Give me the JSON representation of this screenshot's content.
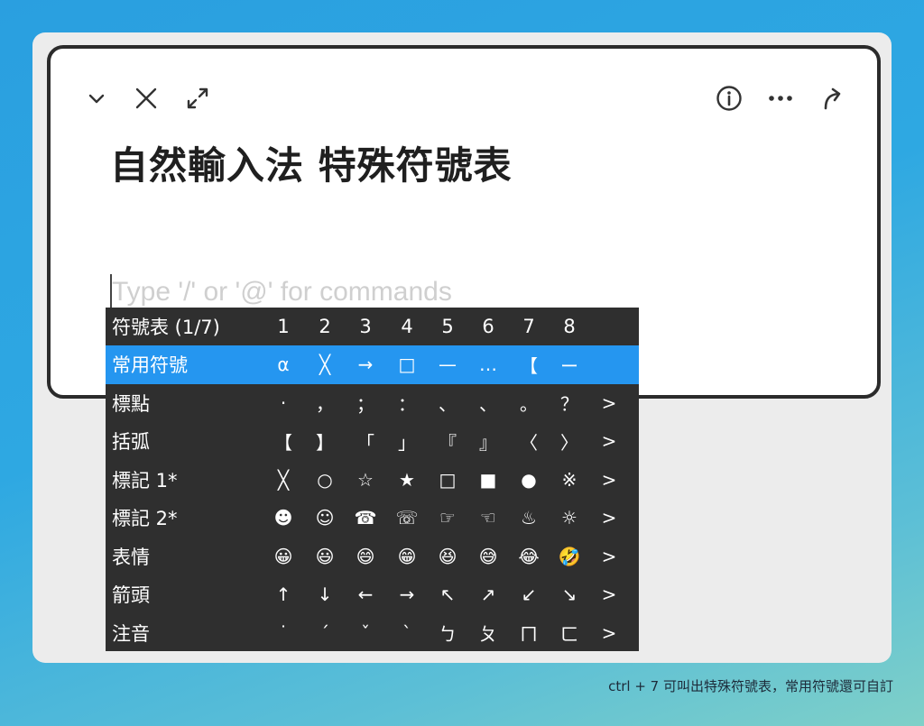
{
  "toolbar": {
    "left_icons": [
      "chevron-down-icon",
      "close-icon",
      "expand-icon"
    ],
    "right_icons": [
      "info-icon",
      "more-icon",
      "share-icon"
    ]
  },
  "page": {
    "title": "自然輸入法 特殊符號表",
    "placeholder": "Type '/' or '@' for commands"
  },
  "palette": {
    "header": {
      "label": "符號表 (1/7)",
      "columns": [
        "1",
        "2",
        "3",
        "4",
        "5",
        "6",
        "7",
        "8"
      ]
    },
    "rows": [
      {
        "label": "常用符號",
        "symbols": [
          "α",
          "╳",
          "→",
          "□",
          "—",
          "…",
          "【",
          "ー"
        ],
        "arrow": "",
        "selected": true
      },
      {
        "label": "標點",
        "symbols": [
          "·",
          "，",
          "；",
          "：",
          "、",
          "、",
          "。",
          "？"
        ],
        "arrow": ">"
      },
      {
        "label": "括弧",
        "symbols": [
          "【",
          "】",
          "「",
          "」",
          "『",
          "』",
          "〈",
          "〉"
        ],
        "arrow": ">"
      },
      {
        "label": "標記 1*",
        "symbols": [
          "╳",
          "○",
          "☆",
          "★",
          "□",
          "■",
          "●",
          "※"
        ],
        "arrow": ">"
      },
      {
        "label": "標記 2*",
        "symbols": [
          "☻",
          "☺",
          "☎",
          "☏",
          "☞",
          "☜",
          "♨",
          "☼"
        ],
        "arrow": ">"
      },
      {
        "label": "表情",
        "symbols": [
          "😀",
          "😃",
          "😄",
          "😁",
          "😆",
          "😅",
          "😂",
          "🤣"
        ],
        "arrow": ">"
      },
      {
        "label": "箭頭",
        "symbols": [
          "↑",
          "↓",
          "←",
          "→",
          "↖",
          "↗",
          "↙",
          "↘"
        ],
        "arrow": ">"
      },
      {
        "label": "注音",
        "symbols": [
          "˙",
          "ˊ",
          "ˇ",
          "ˋ",
          "ㄅ",
          "ㄆ",
          "ㄇ",
          "ㄈ"
        ],
        "arrow": ">"
      }
    ]
  },
  "caption": "ctrl + 7 可叫出特殊符號表，常用符號還可自訂",
  "colors": {
    "selected_row": "#2596f0",
    "palette_bg": "#2f2f2f",
    "window_border": "#2b2b2b"
  }
}
